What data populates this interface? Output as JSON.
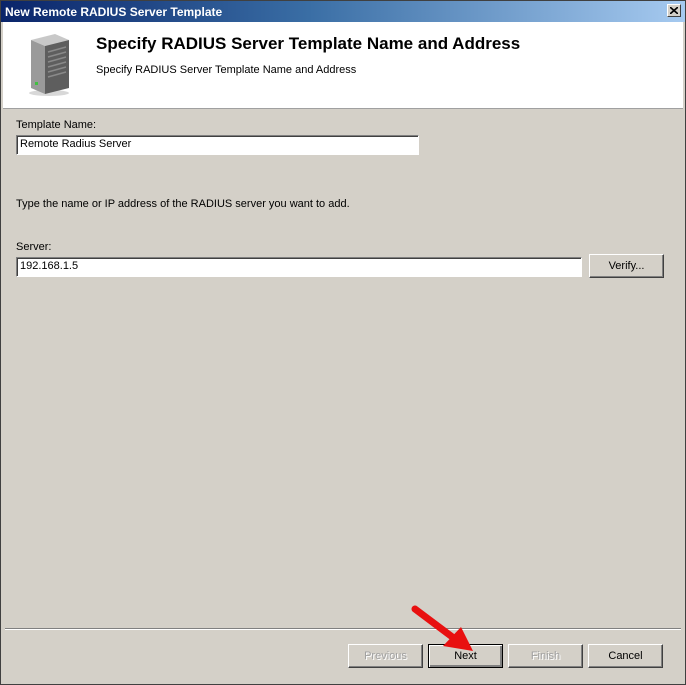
{
  "window": {
    "title": "New Remote RADIUS Server Template"
  },
  "header": {
    "icon": "server-tower-icon",
    "title": "Specify RADIUS Server Template Name and Address",
    "subtitle": "Specify RADIUS Server Template Name and Address"
  },
  "form": {
    "template_name_label": "Template Name:",
    "template_name_value": "Remote Radius Server",
    "instructions": "Type the name or IP address of the RADIUS server you want to add.",
    "server_label": "Server:",
    "server_value": "192.168.1.5",
    "verify_label": "Verify..."
  },
  "footer": {
    "previous_label": "Previous",
    "next_label": "Next",
    "finish_label": "Finish",
    "cancel_label": "Cancel"
  },
  "annotation": {
    "icon": "red-arrow-icon",
    "color": "#e81010"
  }
}
